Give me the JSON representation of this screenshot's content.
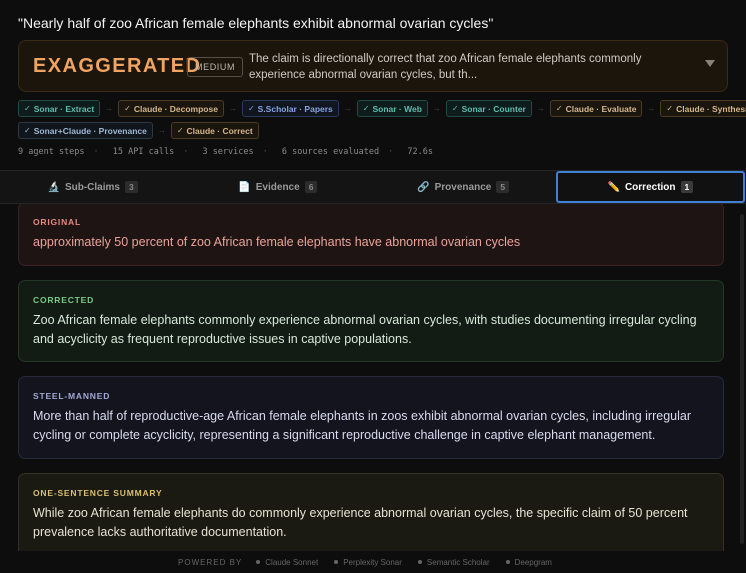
{
  "claim_title": "\"Nearly half of zoo African female elephants exhibit abnormal ovarian cycles\"",
  "verdict": {
    "label": "EXAGGERATED",
    "severity": "MEDIUM",
    "summary": "The claim is directionally correct that zoo African female elephants commonly experience abnormal ovarian cycles, but th...",
    "accent_color": "#f0a462",
    "expand_icon": "chevron-down-icon"
  },
  "pipeline": {
    "row1": [
      {
        "label": "Sonar · Extract",
        "kind": "sonar"
      },
      {
        "label": "Claude · Decompose",
        "kind": "claude"
      },
      {
        "label": "S.Scholar · Papers",
        "kind": "scholar"
      },
      {
        "label": "Sonar · Web",
        "kind": "sonar"
      },
      {
        "label": "Sonar · Counter",
        "kind": "sonar"
      },
      {
        "label": "Claude · Evaluate",
        "kind": "claude"
      },
      {
        "label": "Claude · Synthesize",
        "kind": "claude"
      }
    ],
    "row2": [
      {
        "label": "Sonar+Claude · Provenance",
        "kind": "combo"
      },
      {
        "label": "Claude · Correct",
        "kind": "claude"
      }
    ]
  },
  "stats": [
    "9 agent steps",
    "15 API calls",
    "3 services",
    "6 sources evaluated",
    "72.6s"
  ],
  "tabs": [
    {
      "label": "Sub-Claims",
      "count": "3",
      "icon": "microscope-icon",
      "glyph": "🔬",
      "active": false
    },
    {
      "label": "Evidence",
      "count": "6",
      "icon": "document-icon",
      "glyph": "📄",
      "active": false
    },
    {
      "label": "Provenance",
      "count": "5",
      "icon": "link-icon",
      "glyph": "🔗",
      "active": false
    },
    {
      "label": "Correction",
      "count": "1",
      "icon": "pencil-icon",
      "glyph": "✏️",
      "active": true
    }
  ],
  "correction": {
    "original": {
      "header": "ORIGINAL",
      "text": "approximately 50 percent of zoo African female elephants have abnormal ovarian cycles"
    },
    "corrected": {
      "header": "CORRECTED",
      "text": "Zoo African female elephants commonly experience abnormal ovarian cycles, with studies documenting irregular cycling and acyclicity as frequent reproductive issues in captive populations."
    },
    "steel_manned": {
      "header": "STEEL-MANNED",
      "text": "More than half of reproductive-age African female elephants in zoos exhibit abnormal ovarian cycles, including irregular cycling or complete acyclicity, representing a significant reproductive challenge in captive elephant management."
    },
    "summary": {
      "header": "ONE-SENTENCE SUMMARY",
      "text": "While zoo African female elephants do commonly experience abnormal ovarian cycles, the specific claim of 50 percent prevalence lacks authoritative documentation."
    }
  },
  "footer": {
    "powered_by": "POWERED BY",
    "services": [
      "Claude Sonnet",
      "Perplexity Sonar",
      "Semantic Scholar",
      "Deepgram"
    ]
  }
}
